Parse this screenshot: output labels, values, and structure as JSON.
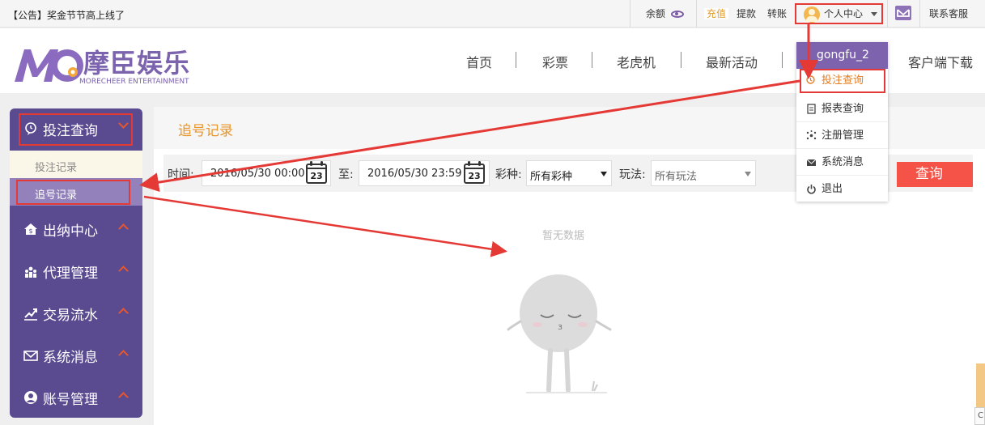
{
  "topbar": {
    "notice": "【公告】奖金节节高上线了",
    "balance_label": "余额",
    "recharge_label": "充值",
    "withdraw_label": "提款",
    "transfer_label": "转账",
    "user_center_label": "个人中心",
    "support_label": "联系客服"
  },
  "header": {
    "logo_title": "摩臣娱乐",
    "logo_subtitle": "MORECHEER ENTERTAINMENT",
    "nav": [
      "首页",
      "彩票",
      "老虎机",
      "最新活动",
      "客户端下载"
    ]
  },
  "dropdown": {
    "username": "gongfu_2",
    "items": [
      "投注查询",
      "报表查询",
      "注册管理",
      "系统消息",
      "退出"
    ]
  },
  "sidebar": {
    "active_group": "投注查询",
    "sub_items": [
      "投注记录",
      "追号记录"
    ],
    "groups": [
      "出纳中心",
      "代理管理",
      "交易流水",
      "系统消息",
      "账号管理"
    ]
  },
  "main": {
    "title": "追号记录",
    "filter": {
      "time_label": "时间:",
      "start_date": "2016/05/30 00:00",
      "to_label": "至:",
      "end_date": "2016/05/30 23:59",
      "calendar_day": "23",
      "lottery_label": "彩种:",
      "lottery_value": "所有彩种",
      "play_label": "玩法:",
      "play_value": "所有玩法",
      "query_button": "查询"
    },
    "empty_text": "暂无数据"
  },
  "colors": {
    "brand_purple": "#5a4a8f",
    "accent_orange": "#e8962b",
    "query_red": "#f55348",
    "annotation_red": "#e53935"
  }
}
